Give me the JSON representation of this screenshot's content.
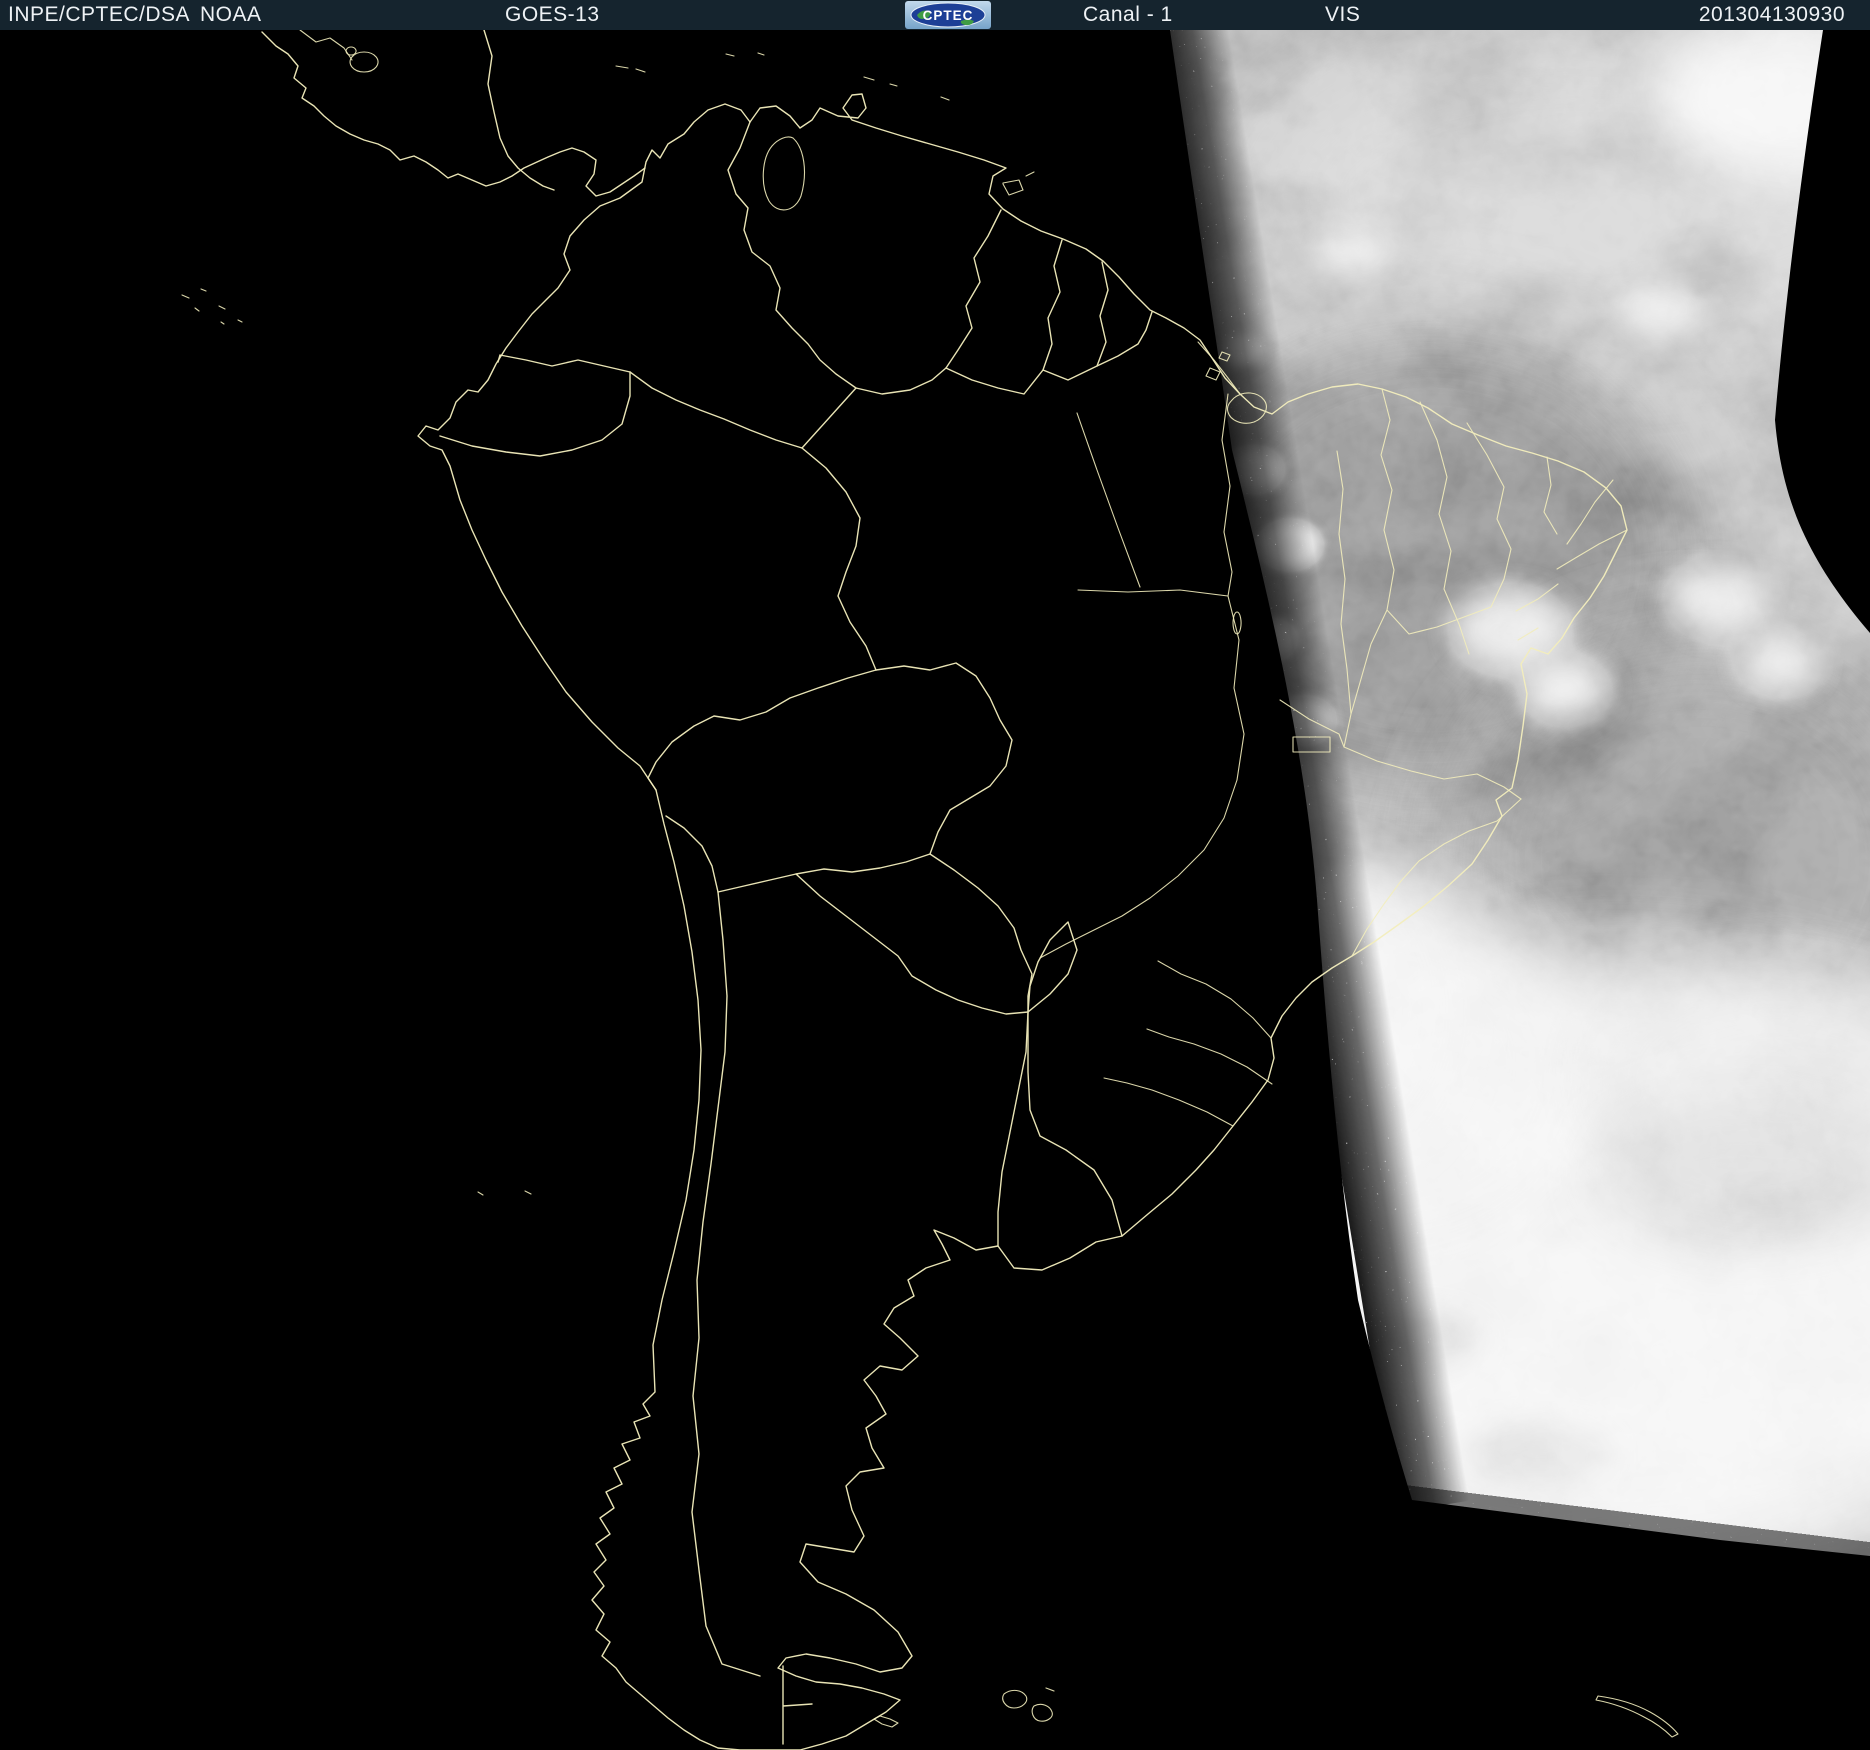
{
  "header": {
    "agency": "INPE/CPTEC/DSA",
    "organization": "NOAA",
    "satellite": "GOES-13",
    "logo_text": "CPTEC",
    "channel": "Canal - 1",
    "band": "VIS",
    "timestamp": "201304130930",
    "bg_color": "#15242e",
    "text_color": "#eef2f5"
  },
  "map": {
    "description": "GOES-13 visible-channel satellite image: night side of South America black with pale-yellow political outlines, sunlit eastern sector showing grayscale cloud imagery",
    "outline_color": "#f2edbc",
    "night_color": "#000000",
    "day_cloud_bright": "#f0f0f0",
    "day_land_gray": "#5e5e5e",
    "regions_outlined": [
      "Central America",
      "Caribbean islands",
      "Colombia",
      "Venezuela",
      "Guyana",
      "Suriname",
      "French Guiana",
      "Ecuador",
      "Peru",
      "Brazil states",
      "Bolivia",
      "Paraguay",
      "Chile",
      "Argentina",
      "Uruguay",
      "Galapagos Islands",
      "Falkland Islands",
      "Tierra del Fuego",
      "South Georgia"
    ]
  }
}
